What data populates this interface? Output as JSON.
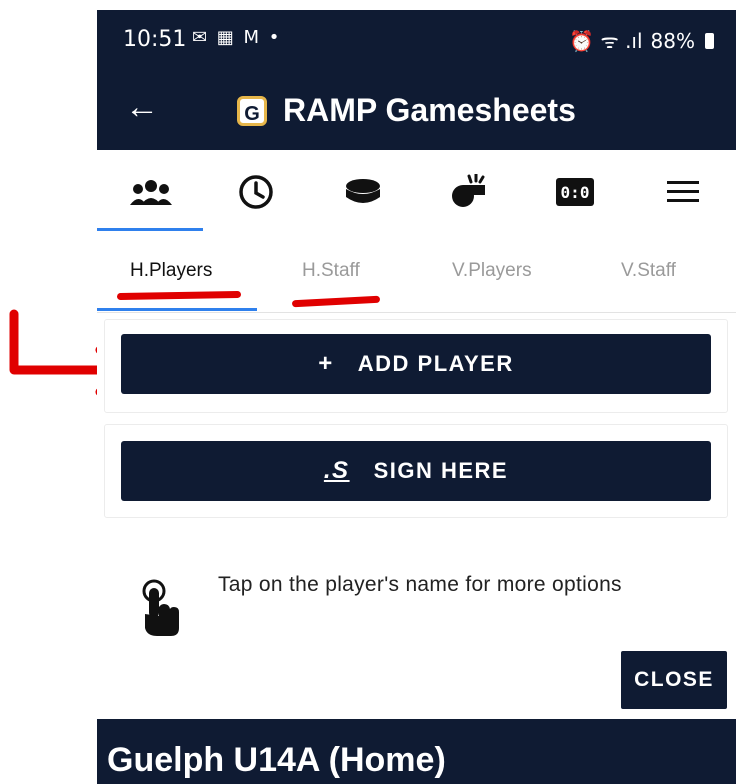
{
  "status": {
    "time": "10:51",
    "notif_icons": "✉ ▦ M •",
    "right_icons": "⏰ ᯤ .ıl",
    "battery": "88%"
  },
  "appbar": {
    "logo_letter": "G",
    "title": "RAMP Gamesheets"
  },
  "icon_tabs": [
    {
      "icon": "team-icon"
    },
    {
      "icon": "clock-icon"
    },
    {
      "icon": "puck-icon"
    },
    {
      "icon": "whistle-icon"
    },
    {
      "icon": "scoreboard-icon"
    },
    {
      "icon": "menu-icon"
    }
  ],
  "scoreboard_text": "0:0",
  "subtabs": [
    "H.Players",
    "H.Staff",
    "V.Players",
    "V.Staff"
  ],
  "buttons": {
    "add_player": "ADD PLAYER",
    "add_icon": "+",
    "sign_here": "SIGN HERE",
    "sign_icon": ".S",
    "close": "CLOSE"
  },
  "hint": "Tap on the player's name for more options",
  "team": "Guelph U14A (Home)",
  "colors": {
    "navy": "#0f1b33",
    "accent_blue": "#2f80ed",
    "annotation_red": "#e00000"
  }
}
